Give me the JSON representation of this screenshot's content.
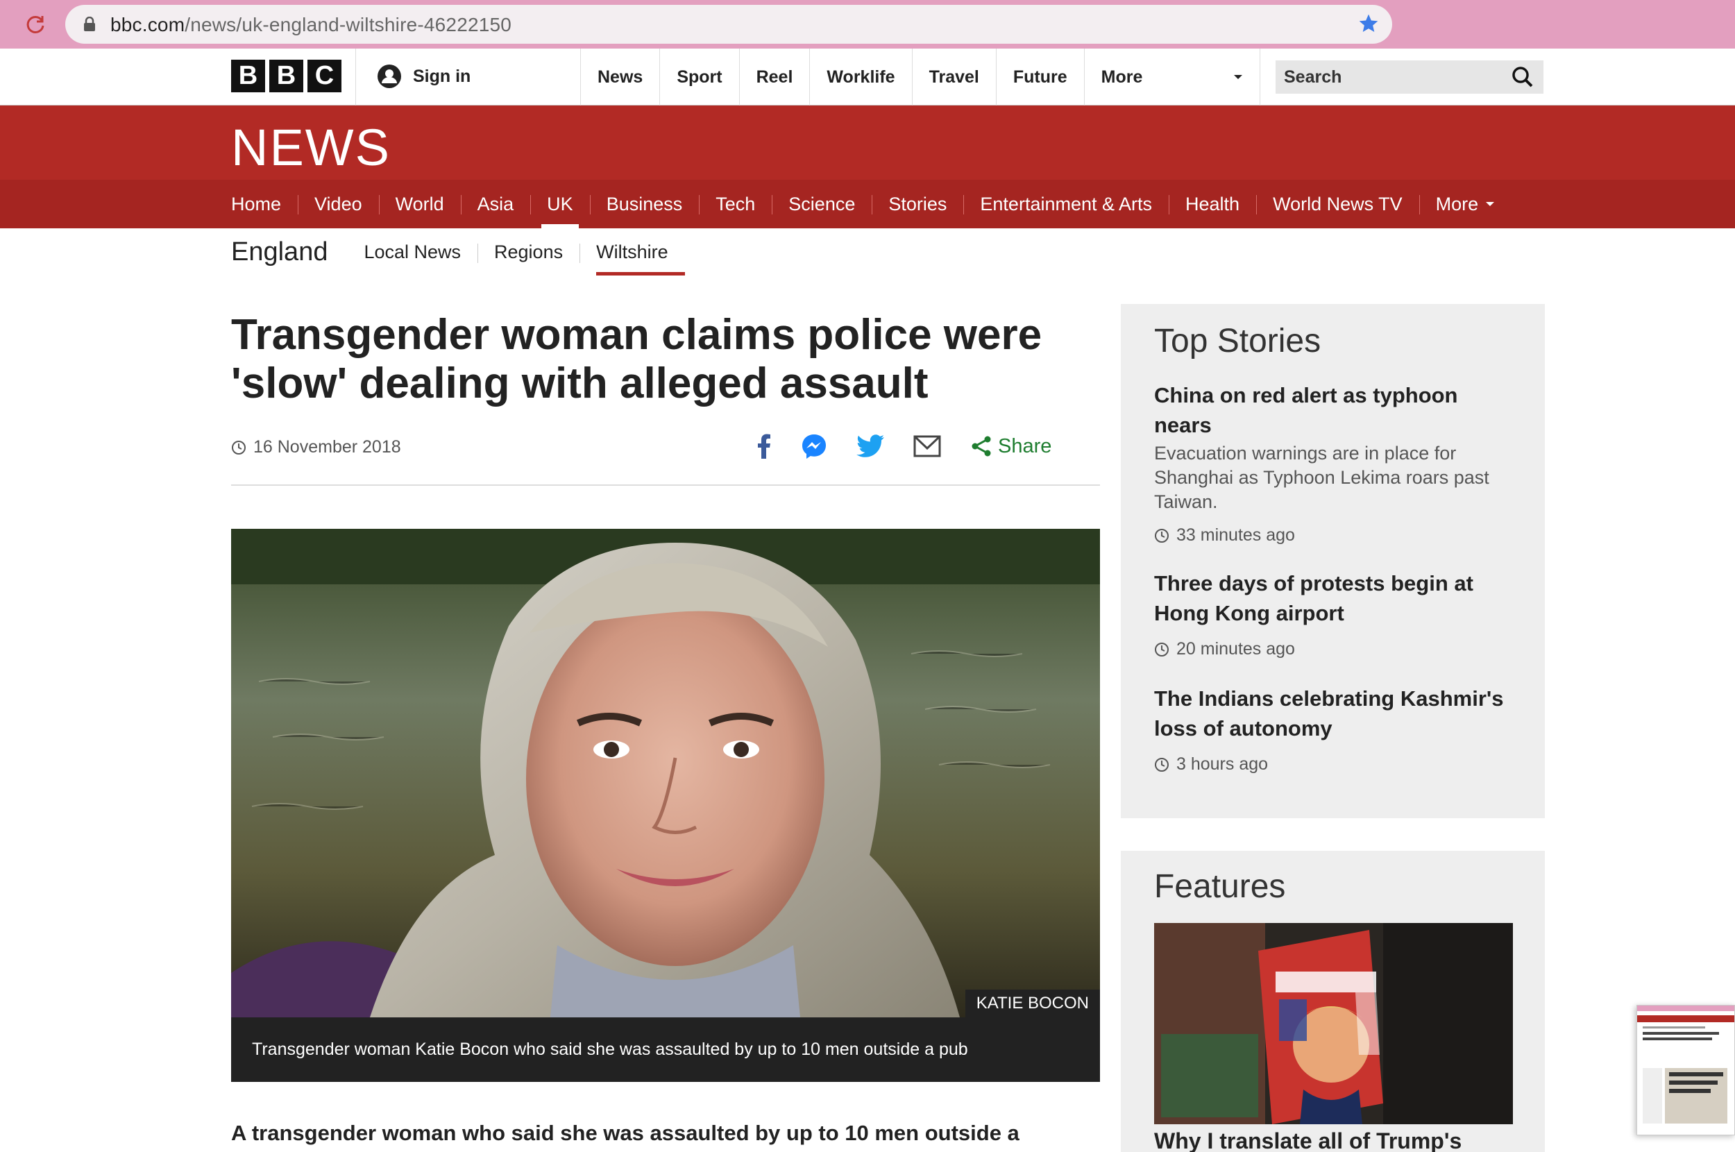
{
  "browser": {
    "url_host": "bbc.com",
    "url_path": "/news/uk-england-wiltshire-46222150"
  },
  "global_nav": {
    "logo_letters": [
      "B",
      "B",
      "C"
    ],
    "sign_in": "Sign in",
    "items": [
      "News",
      "Sport",
      "Reel",
      "Worklife",
      "Travel",
      "Future"
    ],
    "more": "More",
    "search_placeholder": "Search"
  },
  "masthead": {
    "title": "NEWS"
  },
  "section_nav": {
    "items": [
      "Home",
      "Video",
      "World",
      "Asia",
      "UK",
      "Business",
      "Tech",
      "Science",
      "Stories",
      "Entertainment & Arts",
      "Health",
      "World News TV"
    ],
    "more": "More",
    "active": "UK"
  },
  "sub_nav": {
    "title": "England",
    "items": [
      "Local News",
      "Regions",
      "Wiltshire"
    ],
    "active": "Wiltshire"
  },
  "article": {
    "headline_line1": "Transgender woman claims police were",
    "headline_line2": "'slow' dealing with alleged assault",
    "date": "16 November 2018",
    "share_label": "Share",
    "image_credit": "KATIE BOCON",
    "caption": "Transgender woman Katie Bocon who said she was assaulted by up to 10 men outside a pub",
    "lead": "A transgender woman who said she was assaulted by up to 10 men outside a"
  },
  "top_stories": {
    "heading": "Top Stories",
    "stories": [
      {
        "title_l1": "China on red alert as typhoon",
        "title_l2": "nears",
        "desc_l1": "Evacuation warnings are in place for",
        "desc_l2": "Shanghai as Typhoon Lekima roars past",
        "desc_l3": "Taiwan.",
        "time": "33 minutes ago"
      },
      {
        "title_l1": "Three days of protests begin at",
        "title_l2": "Hong Kong airport",
        "time": "20 minutes ago"
      },
      {
        "title_l1": "The Indians celebrating Kashmir's",
        "title_l2": "loss of autonomy",
        "time": "3 hours ago"
      }
    ]
  },
  "features": {
    "heading": "Features",
    "first_title": "Why I translate all of Trump's"
  },
  "colors": {
    "bbc_red": "#b22a25",
    "bbc_red_dark": "#a52521",
    "chrome_pink": "#e39fbf",
    "share_green": "#1e7d2f"
  }
}
